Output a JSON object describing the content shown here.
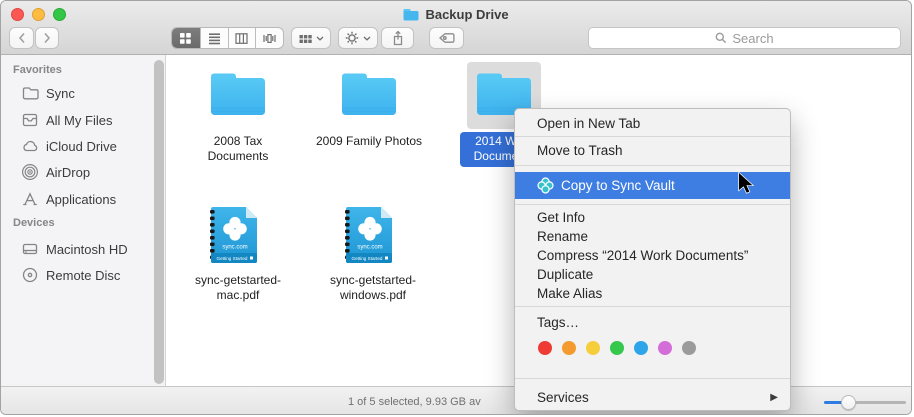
{
  "window": {
    "title": "Backup Drive",
    "controls": [
      "close",
      "minimize",
      "zoom"
    ]
  },
  "toolbar": {
    "view_modes": [
      "icon-view",
      "list-view",
      "column-view",
      "cover-flow-view"
    ],
    "selected_view": "icon-view",
    "search": {
      "placeholder": "Search"
    }
  },
  "sidebar": {
    "sections": [
      {
        "title": "Favorites",
        "items": [
          {
            "label": "Sync",
            "icon": "folder-icon"
          },
          {
            "label": "All My Files",
            "icon": "documents-icon"
          },
          {
            "label": "iCloud Drive",
            "icon": "cloud-icon"
          },
          {
            "label": "AirDrop",
            "icon": "airdrop-icon"
          },
          {
            "label": "Applications",
            "icon": "applications-icon"
          }
        ]
      },
      {
        "title": "Devices",
        "items": [
          {
            "label": "Macintosh HD",
            "icon": "hard-drive-icon"
          },
          {
            "label": "Remote Disc",
            "icon": "disc-icon"
          }
        ]
      }
    ]
  },
  "files": [
    {
      "name": "2008 Tax Documents",
      "type": "folder",
      "lines": [
        "2008 Tax",
        "Documents"
      ],
      "selected": false
    },
    {
      "name": "2009 Family Photos",
      "type": "folder",
      "lines": [
        "2009 Family Photos"
      ],
      "selected": false
    },
    {
      "name": "2014 Work Documents",
      "type": "folder",
      "lines": [
        "2014 Work",
        "Documents"
      ],
      "selected": true
    },
    {
      "name": "sync-getstarted-mac.pdf",
      "type": "pdf",
      "lines": [
        "sync-getstarted-",
        "mac.pdf"
      ],
      "selected": false
    },
    {
      "name": "sync-getstarted-windows.pdf",
      "type": "pdf",
      "lines": [
        "sync-getstarted-",
        "windows.pdf"
      ],
      "selected": false
    }
  ],
  "pdf_icon": {
    "logo_text": "sync.com",
    "footer_text": "Getting Started"
  },
  "context_menu": {
    "items": [
      {
        "label": "Open in New Tab"
      },
      {
        "label": "Move to Trash"
      },
      {
        "label": "Copy to Sync Vault",
        "highlighted": true,
        "icon": "sync-vault-icon"
      },
      {
        "label": "Get Info"
      },
      {
        "label": "Rename"
      },
      {
        "label": "Compress “2014 Work Documents”"
      },
      {
        "label": "Duplicate"
      },
      {
        "label": "Make Alias"
      },
      {
        "label": "Tags…"
      },
      {
        "label": "Services",
        "has_submenu": true
      }
    ],
    "tag_colors": [
      "#EE3B34",
      "#F59A2E",
      "#F6CE3C",
      "#35C84C",
      "#2EA5E8",
      "#D36DD8",
      "#9B9B9B"
    ]
  },
  "status_bar": {
    "text": "1 of 5 selected, 9.93 GB av",
    "zoom_slider_position": "30%"
  },
  "colors": {
    "menu_highlight": "#3E7DE1",
    "selection_label": "#3470D8",
    "folder_blue": "#47BCF1",
    "pdf_blue": "#2AA9E0"
  }
}
